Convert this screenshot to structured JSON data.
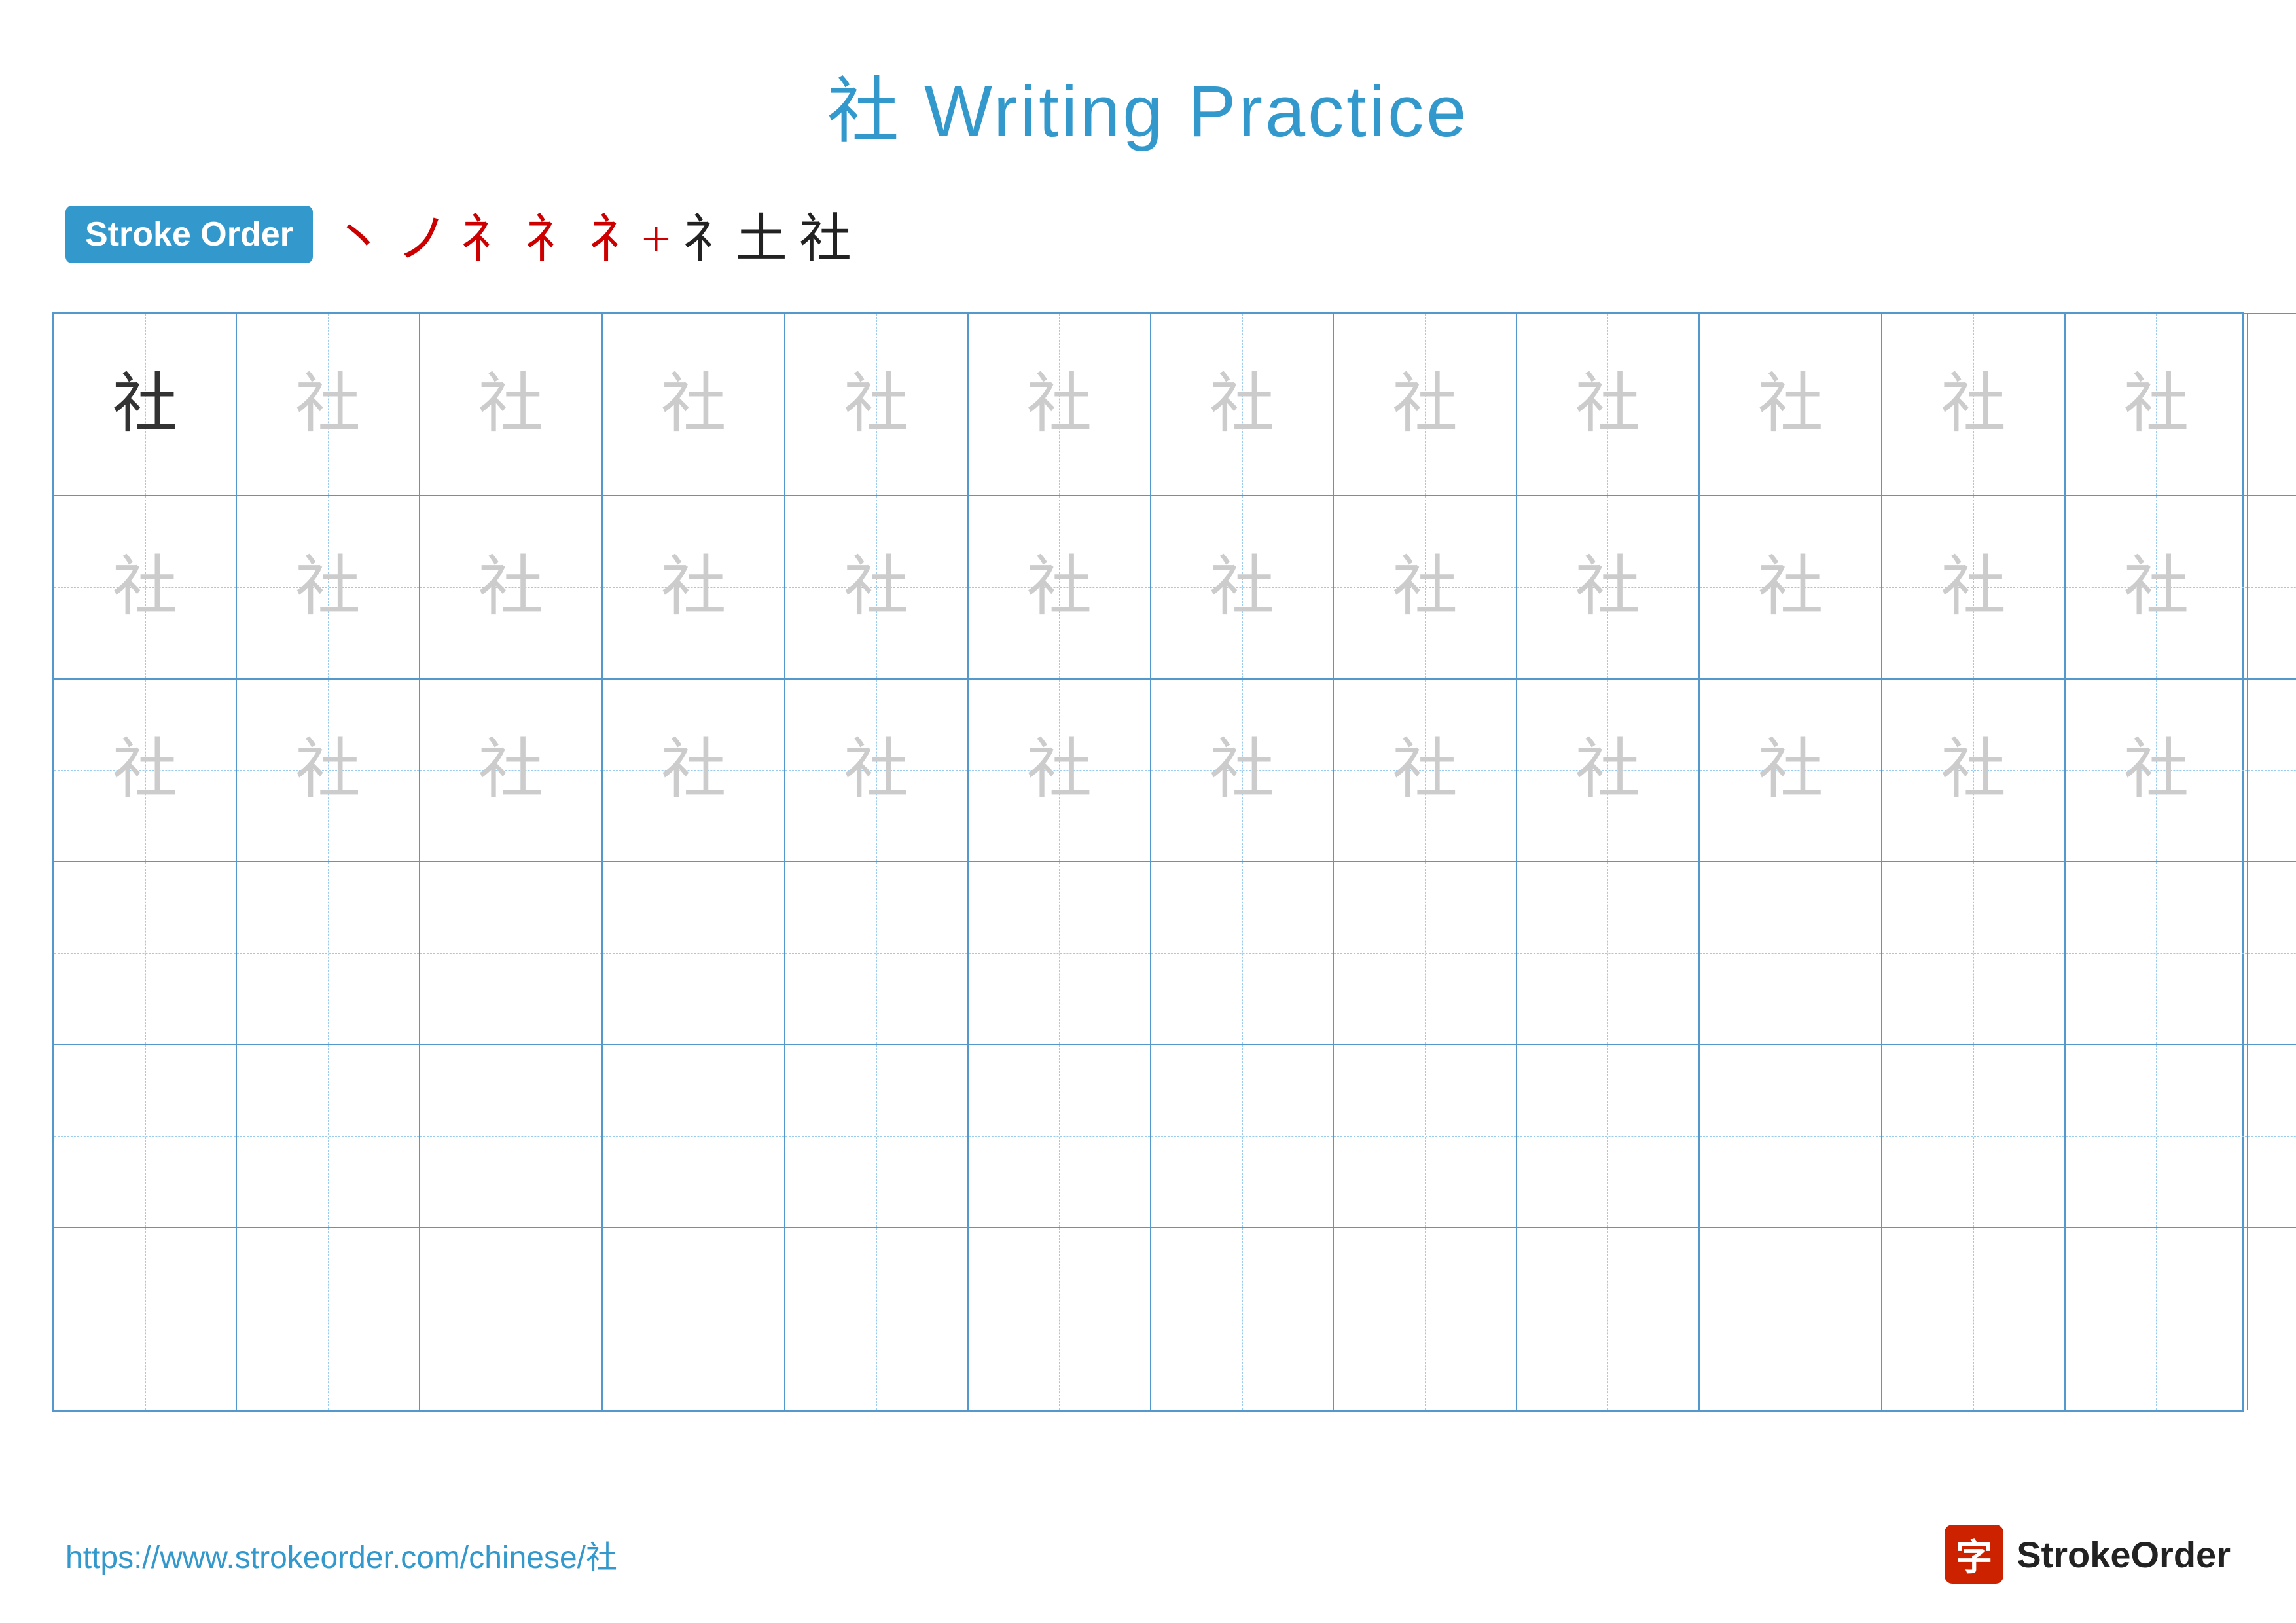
{
  "page": {
    "title": "社 Writing Practice",
    "url": "https://www.strokeorder.com/chinese/社",
    "brand_name": "StrokeOrder",
    "brand_icon_char": "字",
    "stroke_order_label": "Stroke Order",
    "stroke_sequence": [
      "丶",
      "ノ",
      "礻",
      "礻",
      "礻礻",
      "礻土",
      "社"
    ],
    "accent_color": "#3399cc",
    "grid": {
      "rows": 6,
      "cols": 13,
      "cells": [
        {
          "row": 0,
          "col": 0,
          "char": "社",
          "style": "dark"
        },
        {
          "row": 0,
          "col": 1,
          "char": "社",
          "style": "light"
        },
        {
          "row": 0,
          "col": 2,
          "char": "社",
          "style": "light"
        },
        {
          "row": 0,
          "col": 3,
          "char": "社",
          "style": "light"
        },
        {
          "row": 0,
          "col": 4,
          "char": "社",
          "style": "light"
        },
        {
          "row": 0,
          "col": 5,
          "char": "社",
          "style": "light"
        },
        {
          "row": 0,
          "col": 6,
          "char": "社",
          "style": "light"
        },
        {
          "row": 0,
          "col": 7,
          "char": "社",
          "style": "light"
        },
        {
          "row": 0,
          "col": 8,
          "char": "社",
          "style": "light"
        },
        {
          "row": 0,
          "col": 9,
          "char": "社",
          "style": "light"
        },
        {
          "row": 0,
          "col": 10,
          "char": "社",
          "style": "light"
        },
        {
          "row": 0,
          "col": 11,
          "char": "社",
          "style": "light"
        },
        {
          "row": 0,
          "col": 12,
          "char": "社",
          "style": "light"
        },
        {
          "row": 1,
          "col": 0,
          "char": "社",
          "style": "light"
        },
        {
          "row": 1,
          "col": 1,
          "char": "社",
          "style": "light"
        },
        {
          "row": 1,
          "col": 2,
          "char": "社",
          "style": "light"
        },
        {
          "row": 1,
          "col": 3,
          "char": "社",
          "style": "light"
        },
        {
          "row": 1,
          "col": 4,
          "char": "社",
          "style": "light"
        },
        {
          "row": 1,
          "col": 5,
          "char": "社",
          "style": "light"
        },
        {
          "row": 1,
          "col": 6,
          "char": "社",
          "style": "light"
        },
        {
          "row": 1,
          "col": 7,
          "char": "社",
          "style": "light"
        },
        {
          "row": 1,
          "col": 8,
          "char": "社",
          "style": "light"
        },
        {
          "row": 1,
          "col": 9,
          "char": "社",
          "style": "light"
        },
        {
          "row": 1,
          "col": 10,
          "char": "社",
          "style": "light"
        },
        {
          "row": 1,
          "col": 11,
          "char": "社",
          "style": "light"
        },
        {
          "row": 1,
          "col": 12,
          "char": "社",
          "style": "light"
        },
        {
          "row": 2,
          "col": 0,
          "char": "社",
          "style": "light"
        },
        {
          "row": 2,
          "col": 1,
          "char": "社",
          "style": "light"
        },
        {
          "row": 2,
          "col": 2,
          "char": "社",
          "style": "light"
        },
        {
          "row": 2,
          "col": 3,
          "char": "社",
          "style": "light"
        },
        {
          "row": 2,
          "col": 4,
          "char": "社",
          "style": "light"
        },
        {
          "row": 2,
          "col": 5,
          "char": "社",
          "style": "light"
        },
        {
          "row": 2,
          "col": 6,
          "char": "社",
          "style": "light"
        },
        {
          "row": 2,
          "col": 7,
          "char": "社",
          "style": "light"
        },
        {
          "row": 2,
          "col": 8,
          "char": "社",
          "style": "light"
        },
        {
          "row": 2,
          "col": 9,
          "char": "社",
          "style": "light"
        },
        {
          "row": 2,
          "col": 10,
          "char": "社",
          "style": "light"
        },
        {
          "row": 2,
          "col": 11,
          "char": "社",
          "style": "light"
        },
        {
          "row": 2,
          "col": 12,
          "char": "社",
          "style": "light"
        }
      ]
    }
  }
}
